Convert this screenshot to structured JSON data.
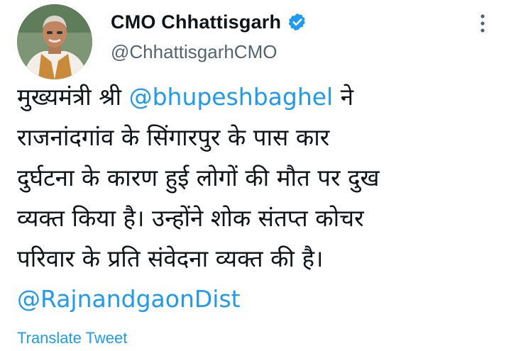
{
  "author": {
    "display_name": "CMO Chhattisgarh",
    "handle": "@ChhattisgarhCMO",
    "verified": true,
    "verified_icon": "verified-badge-icon",
    "accent_color": "#1d9bf0"
  },
  "tweet": {
    "line1_prefix": "मुख्यमंत्री श्री ",
    "line1_mention": "@bhupeshbaghel",
    "line1_suffix": " ने",
    "line2": "राजनांदगांव के सिंगारपुर के पास कार",
    "line3": "दुर्घटना के कारण हुई लोगों की मौत पर दुख",
    "line4": "व्यक्त किया है। उन्होंने शोक संतप्त कोचर",
    "line5": "परिवार के प्रति संवेदना व्यक्त की है।",
    "line6_mention": "@RajnandgaonDist"
  },
  "actions": {
    "translate_label": "Translate Tweet",
    "more_icon": "more-options-icon"
  }
}
